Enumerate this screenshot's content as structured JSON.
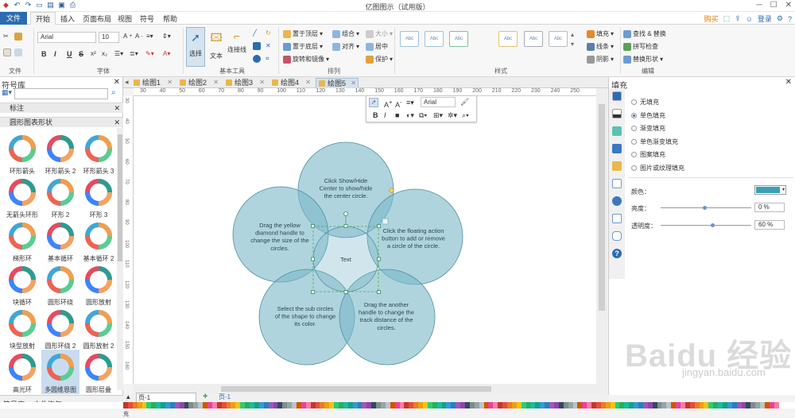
{
  "app": {
    "title": "亿图图示（试用版）"
  },
  "menu": {
    "file": "文件",
    "items": [
      "开始",
      "插入",
      "页面布局",
      "视图",
      "符号",
      "帮助"
    ],
    "buy": "购买",
    "login": "登录"
  },
  "ribbon": {
    "groups": [
      "文件",
      "字体",
      "基本工具",
      "排列",
      "样式",
      "编辑"
    ],
    "font_name": "Arial",
    "font_size": "10",
    "format_buttons": [
      "B",
      "I",
      "U",
      "S"
    ],
    "tools": [
      "选择",
      "文本",
      "连接线"
    ],
    "arrange": [
      "置于顶层",
      "置于底层",
      "旋转和镜像",
      "组合",
      "对齐",
      "大小",
      "居中",
      "保护"
    ],
    "style_sample": "Abc",
    "fill_items": [
      "填充",
      "线条",
      "阴影"
    ],
    "edit": [
      "查找 & 替换",
      "拼写检查",
      "替换形状"
    ]
  },
  "library": {
    "title": "符号库",
    "category1": "标注",
    "category2": "圆形图表形状",
    "shapes": [
      "环形箭头",
      "环形箭头 2",
      "环形箭头 3",
      "无箭头环形",
      "环形 2",
      "环形 3",
      "梯形环",
      "基本循环",
      "基本循环 2",
      "块循环",
      "圆形环绕",
      "圆形放射",
      "块型放射",
      "圆形环绕 2",
      "圆形放射 2",
      "高光环",
      "多圆维恩图",
      "圆形层叠"
    ],
    "selected": "多圆维恩图"
  },
  "tabs": [
    "绘图1",
    "绘图2",
    "绘图3",
    "绘图4",
    "绘图5"
  ],
  "active_tab": "绘图5",
  "ruler_h": [
    "30",
    "40",
    "50",
    "60",
    "70",
    "80",
    "90",
    "100",
    "110",
    "120",
    "130",
    "140",
    "150",
    "160",
    "170",
    "180",
    "190",
    "200",
    "210",
    "220",
    "230",
    "240",
    "250"
  ],
  "ruler_v": [
    "30",
    "40",
    "50",
    "60",
    "70",
    "80",
    "90",
    "100",
    "110",
    "120",
    "130",
    "140",
    "150",
    "160"
  ],
  "floatbar": {
    "font": "Arial"
  },
  "diagram": {
    "circle_color": "#7ab8c8",
    "center_text": "Text",
    "top_text": [
      "Click Show/Hide",
      "Center to show/hide",
      "the center circle."
    ],
    "left_text": [
      "Drag the yellow",
      "diamond handle to",
      "change the size of the",
      "circles."
    ],
    "right_text": [
      "Click the floating action",
      "button to add or remove",
      "a circle of the circle."
    ],
    "bottom_left_text": [
      "Select the sub circles",
      "of the shape to change",
      "its color."
    ],
    "bottom_right_text": [
      "Drag the another",
      "handle to change the",
      "track distance of the",
      "circles."
    ]
  },
  "pagebar": {
    "page_select": "页-1",
    "page_tab": "页-1"
  },
  "statusbar": {
    "library": "符号库",
    "recover": "文件恢复",
    "fill_label": "填充"
  },
  "rightpanel": {
    "title": "填充",
    "options": [
      "无填充",
      "单色填充",
      "渐变填充",
      "单色渐变填充",
      "图案填充",
      "图片或纹理填充"
    ],
    "selected": "单色填充",
    "color_label": "颜色：",
    "color_value": "#3aa0b8",
    "brightness_label": "亮度：",
    "brightness_value": "0 %",
    "transparency_label": "透明度：",
    "transparency_value": "60 %"
  },
  "watermark": "Baidu 经验",
  "watermark_url": "jingyan.baidu.com"
}
